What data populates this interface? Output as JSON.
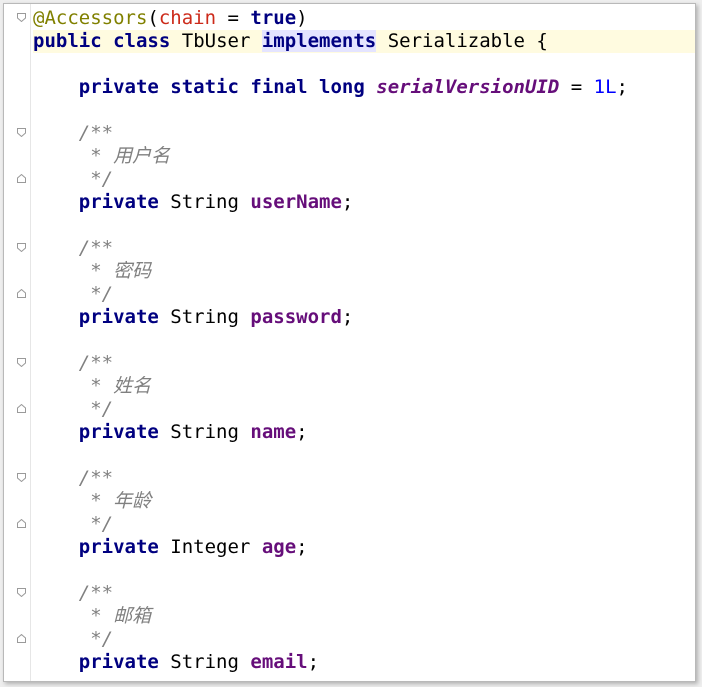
{
  "editor": {
    "lines": [
      {
        "annotation": "@Accessors",
        "open": "(",
        "param": "chain",
        "eq": " = ",
        "value": "true",
        "close": ")"
      },
      {
        "kw_public": "public",
        "kw_class": "class",
        "class_name": "TbUser",
        "kw_implements": "implements",
        "interface": "Serializable",
        "brace": "{"
      },
      {
        "kw_private": "private",
        "kw_static": "static",
        "kw_final": "final",
        "kw_long": "long",
        "field": "serialVersionUID",
        "eq": " = ",
        "number": "1L",
        "semi": ";"
      }
    ],
    "fields": [
      {
        "comment_open": "/**",
        "comment_text": " * 用户名",
        "comment_close": " */",
        "modifier": "private",
        "type": "String",
        "name": "userName",
        "semi": ";"
      },
      {
        "comment_open": "/**",
        "comment_text": " * 密码",
        "comment_close": " */",
        "modifier": "private",
        "type": "String",
        "name": "password",
        "semi": ";"
      },
      {
        "comment_open": "/**",
        "comment_text": " * 姓名",
        "comment_close": " */",
        "modifier": "private",
        "type": "String",
        "name": "name",
        "semi": ";"
      },
      {
        "comment_open": "/**",
        "comment_text": " * 年龄",
        "comment_close": " */",
        "modifier": "private",
        "type": "Integer",
        "name": "age",
        "semi": ";"
      },
      {
        "comment_open": "/**",
        "comment_text": " * 邮箱",
        "comment_close": " */",
        "modifier": "private",
        "type": "String",
        "name": "email",
        "semi": ";"
      }
    ]
  },
  "colors": {
    "keyword": "#000080",
    "annotation": "#808000",
    "annotation_param": "#cc2a1a",
    "field": "#660e7a",
    "number": "#0000ff",
    "comment": "#808080",
    "current_line": "#fffbe0",
    "word_highlight": "#e4e4ff"
  }
}
